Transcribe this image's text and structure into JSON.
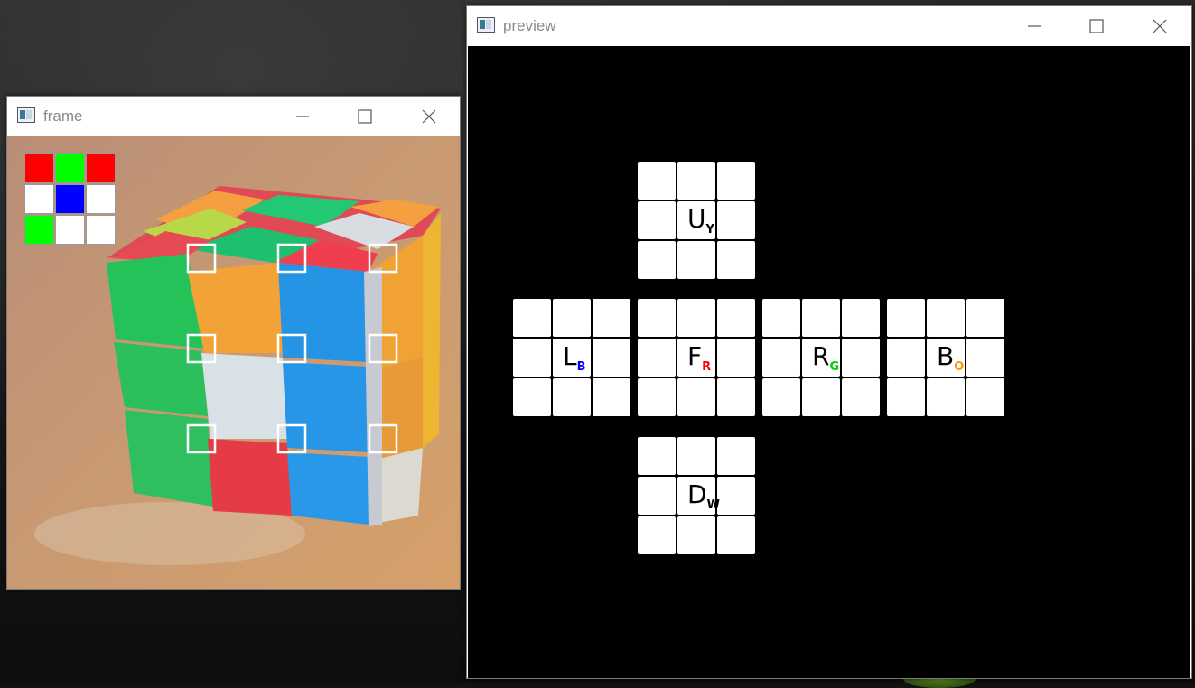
{
  "windows": {
    "frame": {
      "title": "frame",
      "detected_colors": [
        [
          "#ff0000",
          "#00ff00",
          "#ff0000"
        ],
        [
          "#ffffff",
          "#0000ff",
          "#ffffff"
        ],
        [
          "#00ff00",
          "#ffffff",
          "#ffffff"
        ]
      ]
    },
    "preview": {
      "title": "preview",
      "faces": [
        {
          "id": "U",
          "letter": "U",
          "sub": "Y",
          "sub_color": "#000000"
        },
        {
          "id": "L",
          "letter": "L",
          "sub": "B",
          "sub_color": "#0000ff"
        },
        {
          "id": "F",
          "letter": "F",
          "sub": "R",
          "sub_color": "#ff0000"
        },
        {
          "id": "R",
          "letter": "R",
          "sub": "G",
          "sub_color": "#00cc00"
        },
        {
          "id": "B",
          "letter": "B",
          "sub": "O",
          "sub_color": "#ff9900"
        },
        {
          "id": "D",
          "letter": "D",
          "sub": "W",
          "sub_color": "#000000"
        }
      ]
    }
  },
  "controls": {
    "minimize": "minimize-icon",
    "maximize": "maximize-icon",
    "close": "close-icon"
  }
}
